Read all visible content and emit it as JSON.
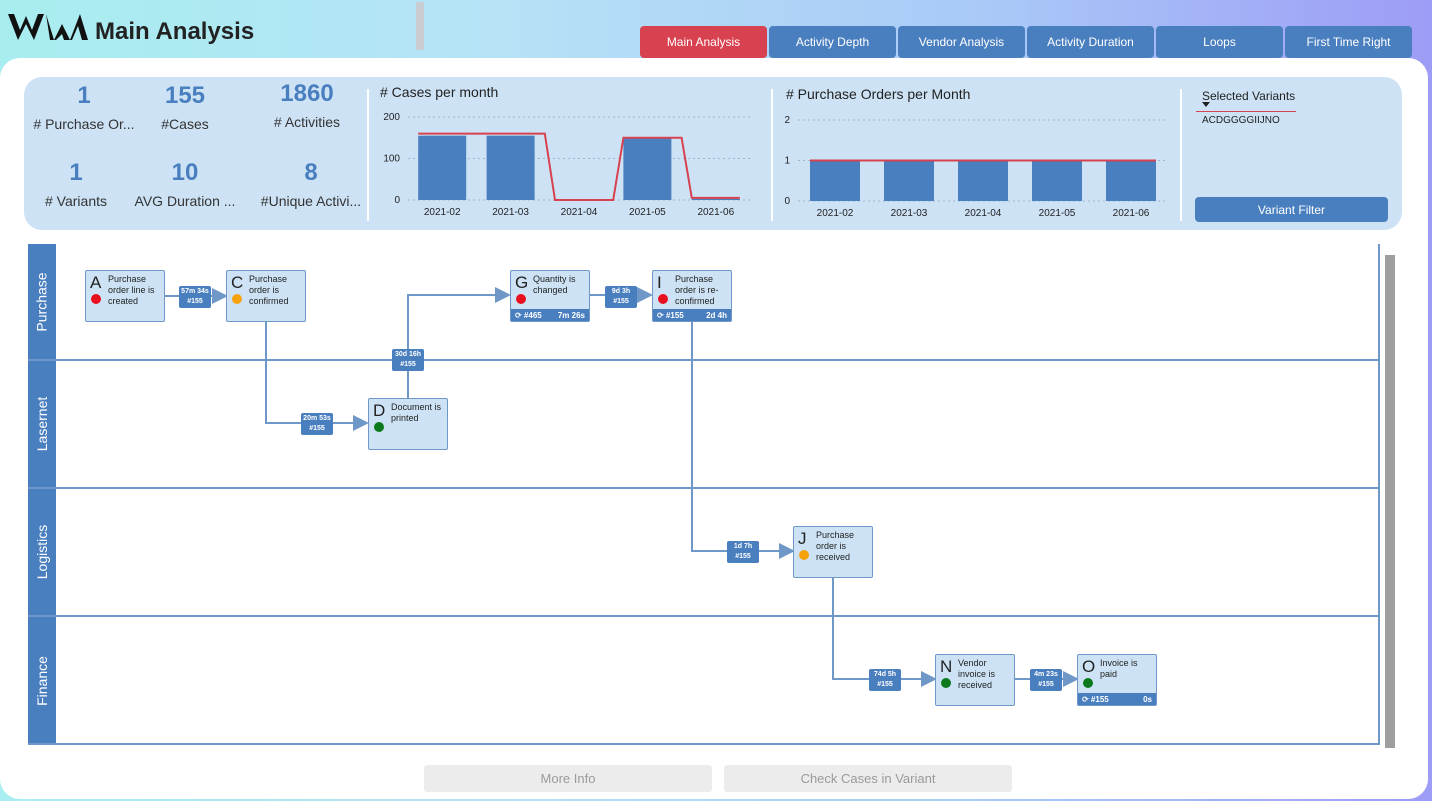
{
  "header": {
    "title": "Main Analysis",
    "logo_icon": "wave-logo-icon"
  },
  "nav": {
    "tabs": [
      {
        "label": "Main Analysis",
        "active": true
      },
      {
        "label": "Activity Depth",
        "active": false
      },
      {
        "label": "Vendor Analysis",
        "active": false
      },
      {
        "label": "Activity Duration",
        "active": false
      },
      {
        "label": "Loops",
        "active": false
      },
      {
        "label": "First Time Right",
        "active": false
      }
    ]
  },
  "kpis": [
    {
      "value": "1",
      "label": "# Purchase Or..."
    },
    {
      "value": "155",
      "label": "#Cases"
    },
    {
      "value": "1860",
      "label": "# Activities"
    },
    {
      "value": "1",
      "label": "# Variants"
    },
    {
      "value": "10",
      "label": "AVG Duration ..."
    },
    {
      "value": "8",
      "label": "#Unique Activi..."
    }
  ],
  "chart_data": [
    {
      "type": "bar",
      "title": "# Cases per month",
      "categories": [
        "2021-02",
        "2021-03",
        "2021-04",
        "2021-05",
        "2021-06"
      ],
      "y_ticks": [
        "200",
        "100",
        "0"
      ],
      "ylim": [
        0,
        200
      ],
      "series": [
        {
          "values": [
            155,
            155,
            0,
            150,
            3
          ]
        },
        {
          "type": "step-line",
          "values": [
            160,
            160,
            0,
            150,
            5
          ]
        }
      ],
      "bar_color": "#4a7fbf",
      "line_color": "#d8414f"
    },
    {
      "type": "bar",
      "title": "# Purchase Orders per Month",
      "categories": [
        "2021-02",
        "2021-03",
        "2021-04",
        "2021-05",
        "2021-06"
      ],
      "y_ticks": [
        "2",
        "1",
        "0"
      ],
      "ylim": [
        0,
        2
      ],
      "series": [
        {
          "values": [
            1,
            1,
            1,
            1,
            1
          ]
        },
        {
          "type": "step-line",
          "values": [
            1,
            1,
            1,
            1,
            1
          ]
        }
      ],
      "bar_color": "#4a7fbf",
      "line_color": "#d8414f"
    }
  ],
  "variants": {
    "label": "Selected Variants",
    "value": "ACDGGGGIIJNO",
    "filter_button": "Variant Filter"
  },
  "lanes": [
    "Purchase",
    "Lasernet",
    "Logistics",
    "Finance"
  ],
  "nodes": [
    {
      "letter": "A",
      "text": "Purchase order line is created",
      "status": "red",
      "foot": null
    },
    {
      "letter": "C",
      "text": "Purchase order is confirmed",
      "status": "orange",
      "foot": null
    },
    {
      "letter": "D",
      "text": "Document is printed",
      "status": "green",
      "foot": null
    },
    {
      "letter": "G",
      "text": "Quantity is changed",
      "status": "red",
      "foot": {
        "count": "⟳ #465",
        "duration": "7m 26s"
      }
    },
    {
      "letter": "I",
      "text": "Purchase order is re-confirmed",
      "status": "red",
      "foot": {
        "count": "⟳ #155",
        "duration": "2d 4h"
      }
    },
    {
      "letter": "J",
      "text": "Purchase order is received",
      "status": "orange",
      "foot": null
    },
    {
      "letter": "N",
      "text": "Vendor invoice is received",
      "status": "green",
      "foot": null
    },
    {
      "letter": "O",
      "text": "Invoice is paid",
      "status": "green",
      "foot": {
        "count": "⟳ #155",
        "duration": "0s"
      }
    }
  ],
  "edges": [
    {
      "from": "A",
      "to": "C",
      "duration": "57m 34s",
      "count": "#155"
    },
    {
      "from": "C",
      "to": "D",
      "duration": "20m 53s",
      "count": "#155"
    },
    {
      "from": "D",
      "to": "G",
      "duration": "30d 16h",
      "count": "#155"
    },
    {
      "from": "G",
      "to": "I",
      "duration": "9d 3h",
      "count": "#155"
    },
    {
      "from": "I",
      "to": "J",
      "duration": "1d 7h",
      "count": "#155"
    },
    {
      "from": "J",
      "to": "N",
      "duration": "74d 5h",
      "count": "#155"
    },
    {
      "from": "N",
      "to": "O",
      "duration": "4m 23s",
      "count": "#155"
    }
  ],
  "status_colors": {
    "red": "#e8101e",
    "orange": "#f5a20c",
    "green": "#0c7a1c"
  },
  "buttons": {
    "more_info": "More Info",
    "check_cases": "Check Cases in Variant"
  }
}
